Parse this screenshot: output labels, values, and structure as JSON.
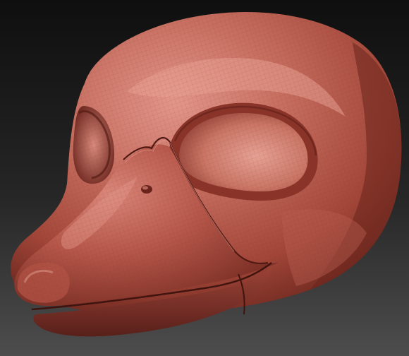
{
  "scene": {
    "subject": "sculpted-duck-head-model",
    "icon": "3d-model-render",
    "colors": {
      "background_top": "#111111",
      "background_bottom": "#4a4a4a",
      "clay_base": "#a8493d",
      "clay_light": "#d07a6a",
      "clay_highlight": "#e8a192",
      "clay_shadow": "#5e1f18",
      "clay_deep_shadow": "#3e130e",
      "wire": "#7e2f26"
    }
  }
}
